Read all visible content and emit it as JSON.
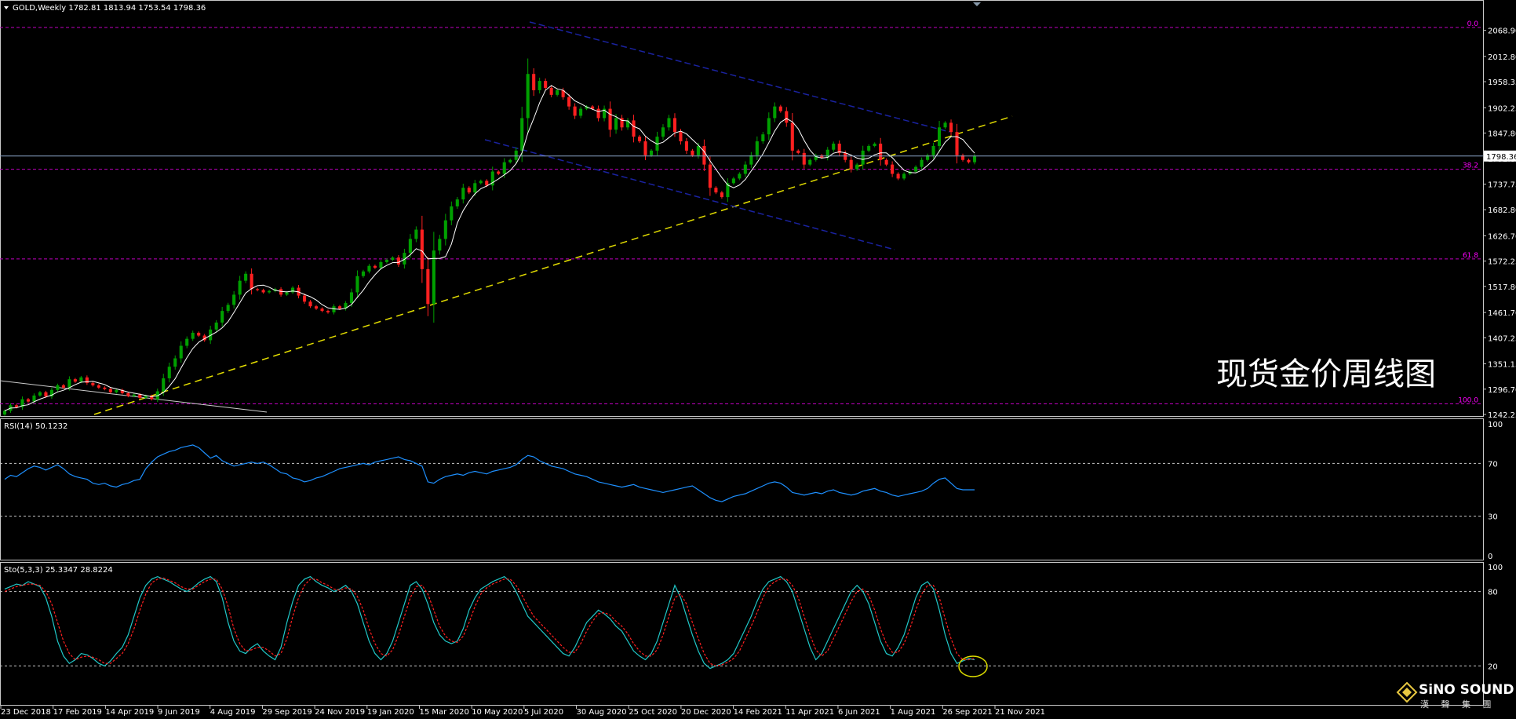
{
  "header": {
    "symbol_line": "GOLD,Weekly  1782.81 1813.94 1753.54 1798.36"
  },
  "price_label": "1798.36",
  "watermark_title": "现货金价周线图",
  "logo": {
    "main": "SiNO SOUND",
    "sub": "漢 聲 集 團"
  },
  "chart_data": [
    {
      "type": "candlestick",
      "title": "GOLD,Weekly",
      "ohlc_last": {
        "open": 1782.81,
        "high": 1813.94,
        "low": 1753.54,
        "close": 1798.36
      },
      "ylim": [
        1242.25,
        2124.0
      ],
      "y_ticks": [
        2068.9,
        2012.8,
        1958.35,
        1902.25,
        1847.8,
        1792.85,
        1737.75,
        1682.8,
        1626.7,
        1572.25,
        1517.8,
        1461.7,
        1407.25,
        1351.15,
        1296.7,
        1242.25
      ],
      "x_tick_labels": [
        "23 Dec 2018",
        "17 Feb 2019",
        "14 Apr 2019",
        "9 Jun 2019",
        "4 Aug 2019",
        "29 Sep 2019",
        "24 Nov 2019",
        "19 Jan 2020",
        "15 Mar 2020",
        "10 May 2020",
        "5 Jul 2020",
        "30 Aug 2020",
        "25 Oct 2020",
        "20 Dec 2020",
        "14 Feb 2021",
        "11 Apr 2021",
        "6 Jun 2021",
        "1 Aug 2021",
        "26 Sep 2021",
        "21 Nov 2021"
      ],
      "fib_levels": [
        {
          "label": "0.0",
          "price": 2075
        },
        {
          "label": "38.2",
          "price": 1770
        },
        {
          "label": "61.8",
          "price": 1577
        },
        {
          "label": "100.0",
          "price": 1265
        }
      ],
      "current_price": 1798.36,
      "close_series": [
        1250,
        1262,
        1258,
        1275,
        1270,
        1283,
        1290,
        1281,
        1295,
        1305,
        1300,
        1318,
        1313,
        1322,
        1310,
        1305,
        1300,
        1297,
        1290,
        1295,
        1288,
        1282,
        1285,
        1278,
        1282,
        1275,
        1292,
        1320,
        1345,
        1363,
        1390,
        1405,
        1418,
        1412,
        1402,
        1425,
        1440,
        1465,
        1478,
        1500,
        1530,
        1545,
        1512,
        1510,
        1505,
        1508,
        1512,
        1500,
        1505,
        1515,
        1498,
        1485,
        1475,
        1470,
        1465,
        1462,
        1475,
        1470,
        1482,
        1505,
        1540,
        1550,
        1562,
        1558,
        1570,
        1575,
        1580,
        1565,
        1590,
        1620,
        1640,
        1555,
        1480,
        1595,
        1620,
        1660,
        1690,
        1705,
        1730,
        1720,
        1740,
        1745,
        1735,
        1765,
        1760,
        1785,
        1790,
        1810,
        1880,
        1975,
        1940,
        1960,
        1945,
        1930,
        1940,
        1925,
        1905,
        1885,
        1900,
        1905,
        1900,
        1880,
        1900,
        1855,
        1880,
        1860,
        1875,
        1840,
        1830,
        1800,
        1810,
        1840,
        1860,
        1880,
        1850,
        1830,
        1810,
        1800,
        1820,
        1780,
        1730,
        1720,
        1710,
        1740,
        1750,
        1760,
        1780,
        1800,
        1830,
        1845,
        1880,
        1905,
        1895,
        1870,
        1810,
        1805,
        1780,
        1790,
        1800,
        1795,
        1812,
        1825,
        1805,
        1790,
        1770,
        1780,
        1810,
        1820,
        1825,
        1790,
        1780,
        1760,
        1750,
        1760,
        1765,
        1775,
        1790,
        1800,
        1820,
        1860,
        1870,
        1850,
        1800,
        1790,
        1785,
        1798
      ]
    },
    {
      "type": "line",
      "title": "RSI(14) 50.1232",
      "ylim": [
        0,
        100
      ],
      "levels": [
        30,
        70
      ],
      "y_ticks": [
        100,
        70,
        30,
        0
      ],
      "series": [
        {
          "name": "RSI(14)",
          "values": [
            58,
            61,
            60,
            63,
            66,
            68,
            67,
            65,
            67,
            69,
            66,
            62,
            60,
            59,
            58,
            55,
            54,
            55,
            53,
            52,
            54,
            55,
            57,
            58,
            66,
            71,
            75,
            77,
            79,
            80,
            82,
            83,
            84,
            82,
            78,
            74,
            76,
            72,
            70,
            68,
            69,
            70,
            71,
            70,
            71,
            69,
            66,
            63,
            62,
            59,
            58,
            56,
            57,
            59,
            60,
            62,
            64,
            66,
            67,
            68,
            69,
            70,
            69,
            71,
            72,
            73,
            74,
            75,
            73,
            72,
            70,
            68,
            56,
            55,
            58,
            60,
            61,
            62,
            61,
            63,
            64,
            63,
            62,
            64,
            65,
            66,
            67,
            69,
            73,
            76,
            75,
            72,
            70,
            68,
            67,
            66,
            64,
            62,
            61,
            60,
            58,
            56,
            55,
            54,
            53,
            52,
            53,
            54,
            52,
            51,
            50,
            49,
            48,
            49,
            50,
            51,
            52,
            53,
            50,
            47,
            44,
            42,
            41,
            43,
            45,
            46,
            47,
            49,
            51,
            53,
            55,
            56,
            55,
            52,
            48,
            47,
            46,
            47,
            48,
            47,
            49,
            50,
            48,
            47,
            46,
            47,
            49,
            50,
            51,
            49,
            48,
            46,
            45,
            46,
            47,
            48,
            49,
            51,
            55,
            58,
            59,
            55,
            51,
            50,
            50,
            50
          ]
        }
      ]
    },
    {
      "type": "line",
      "title": "Sto(5,3,3) 25.3347 28.8224",
      "ylim": [
        0,
        100
      ],
      "levels": [
        20,
        80
      ],
      "y_ticks": [
        100,
        80,
        20
      ],
      "series": [
        {
          "name": "%K",
          "values": [
            82,
            84,
            86,
            85,
            88,
            86,
            84,
            75,
            60,
            40,
            28,
            22,
            25,
            30,
            29,
            26,
            22,
            20,
            24,
            30,
            35,
            45,
            60,
            75,
            85,
            90,
            92,
            90,
            88,
            85,
            82,
            80,
            83,
            87,
            90,
            92,
            88,
            75,
            55,
            40,
            32,
            30,
            35,
            38,
            32,
            28,
            25,
            35,
            55,
            72,
            85,
            90,
            92,
            88,
            85,
            83,
            80,
            82,
            85,
            80,
            70,
            55,
            40,
            30,
            25,
            30,
            40,
            55,
            70,
            85,
            88,
            82,
            70,
            55,
            45,
            40,
            38,
            40,
            50,
            65,
            75,
            82,
            85,
            88,
            90,
            92,
            88,
            80,
            70,
            60,
            55,
            50,
            45,
            40,
            35,
            30,
            28,
            35,
            45,
            55,
            60,
            65,
            62,
            58,
            52,
            48,
            40,
            32,
            28,
            25,
            30,
            40,
            55,
            70,
            85,
            75,
            60,
            45,
            32,
            22,
            18,
            20,
            22,
            25,
            30,
            40,
            50,
            60,
            72,
            82,
            88,
            90,
            92,
            88,
            80,
            65,
            50,
            35,
            25,
            30,
            40,
            50,
            60,
            70,
            80,
            85,
            80,
            70,
            55,
            40,
            30,
            28,
            35,
            45,
            60,
            75,
            85,
            88,
            82,
            65,
            45,
            30,
            22,
            24,
            26,
            25
          ]
        },
        {
          "name": "%D",
          "values": [
            80,
            82,
            84,
            85,
            86,
            86,
            85,
            80,
            70,
            55,
            40,
            30,
            25,
            27,
            28,
            27,
            25,
            22,
            22,
            26,
            30,
            38,
            50,
            65,
            78,
            87,
            90,
            91,
            89,
            87,
            84,
            82,
            82,
            85,
            88,
            90,
            90,
            82,
            68,
            50,
            38,
            32,
            33,
            35,
            35,
            32,
            28,
            30,
            42,
            60,
            75,
            85,
            90,
            90,
            87,
            85,
            82,
            81,
            83,
            82,
            76,
            65,
            50,
            38,
            30,
            28,
            33,
            45,
            60,
            75,
            84,
            85,
            78,
            65,
            52,
            44,
            40,
            39,
            44,
            55,
            68,
            78,
            83,
            86,
            88,
            90,
            90,
            85,
            77,
            68,
            60,
            55,
            50,
            45,
            40,
            35,
            31,
            31,
            38,
            48,
            56,
            62,
            63,
            61,
            56,
            52,
            46,
            38,
            32,
            28,
            28,
            33,
            45,
            60,
            75,
            78,
            70,
            55,
            42,
            30,
            22,
            20,
            21,
            23,
            26,
            32,
            42,
            52,
            63,
            75,
            84,
            88,
            90,
            90,
            85,
            75,
            60,
            45,
            33,
            28,
            32,
            42,
            52,
            62,
            72,
            80,
            82,
            77,
            65,
            50,
            38,
            31,
            31,
            38,
            50,
            65,
            78,
            85,
            85,
            75,
            58,
            42,
            30,
            25,
            25,
            26
          ]
        }
      ]
    }
  ]
}
